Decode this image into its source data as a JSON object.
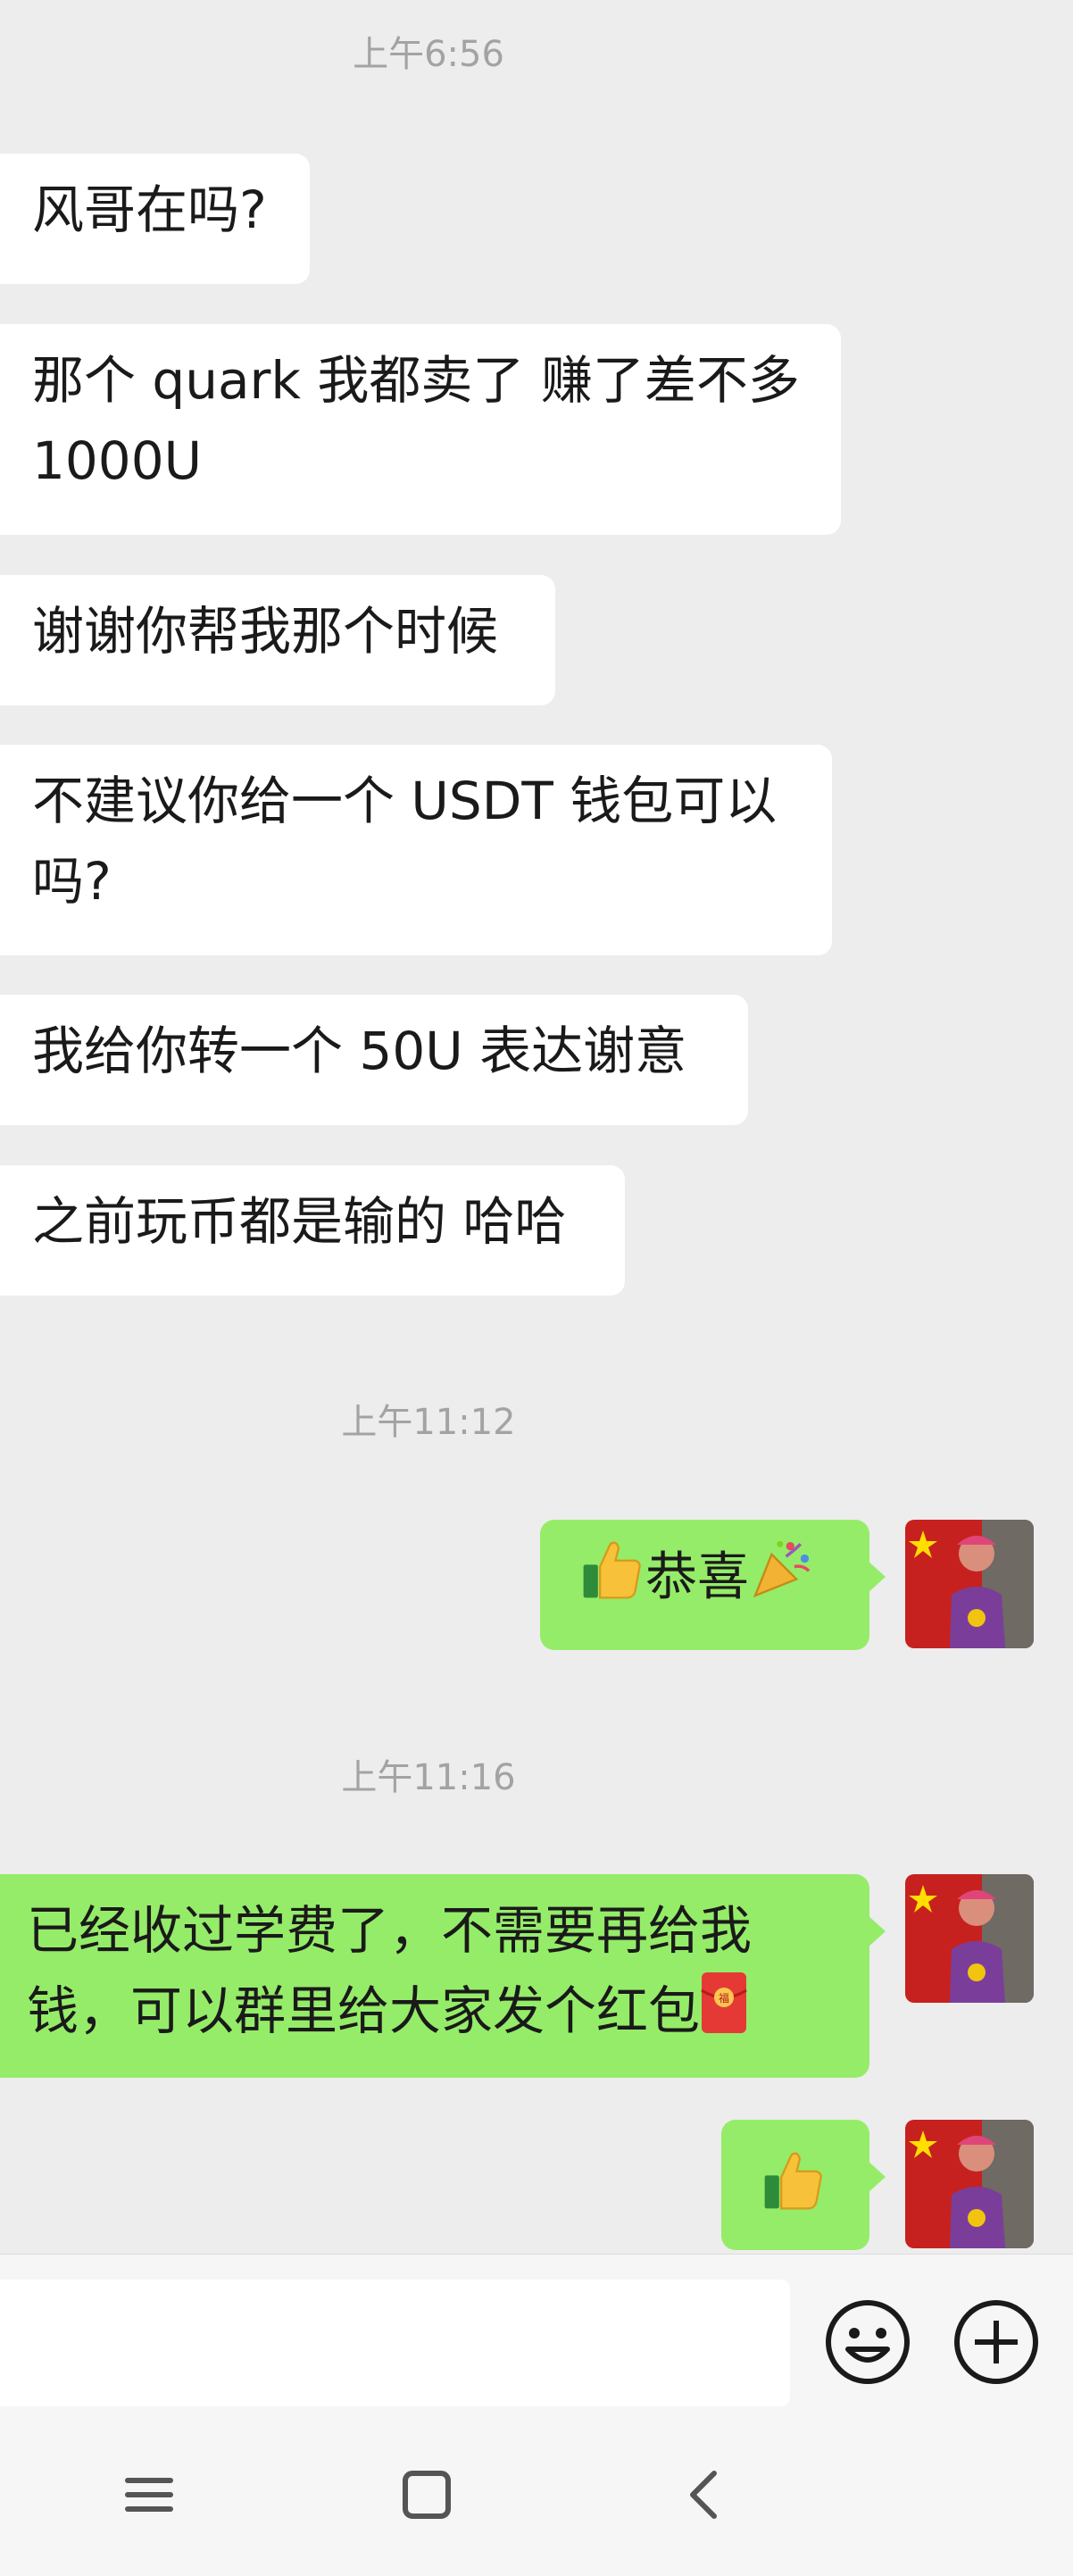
{
  "timestamps": [
    "上午6:56",
    "上午11:12",
    "上午11:16"
  ],
  "incoming_messages": [
    "风哥在吗?",
    "那个 quark 我都卖了 赚了差不多 1000U",
    "谢谢你帮我那个时候",
    "不建议你给一个 USDT 钱包可以吗?",
    "我给你转一个 50U 表达谢意",
    "之前玩币都是输的 哈哈"
  ],
  "outgoing_messages": {
    "congrats_text": "恭喜",
    "tuition_text": "已经收过学费了，不需要再给我钱，可以群里给大家发个红包"
  },
  "icons": {
    "thumbs_up": "thumbs-up-emoji",
    "party_popper": "party-popper-emoji",
    "red_envelope": "red-envelope-emoji",
    "red_envelope_char": "福",
    "emoji_button": "smiley-icon",
    "more_button": "plus-circle-icon",
    "nav_menu": "menu-icon",
    "nav_home": "square-icon",
    "nav_back": "back-chevron-icon"
  },
  "colors": {
    "background": "#ededed",
    "incoming_bubble": "#ffffff",
    "outgoing_bubble": "#95ec69",
    "timestamp_text": "#a3a3a3"
  },
  "composer": {
    "input_value": ""
  }
}
